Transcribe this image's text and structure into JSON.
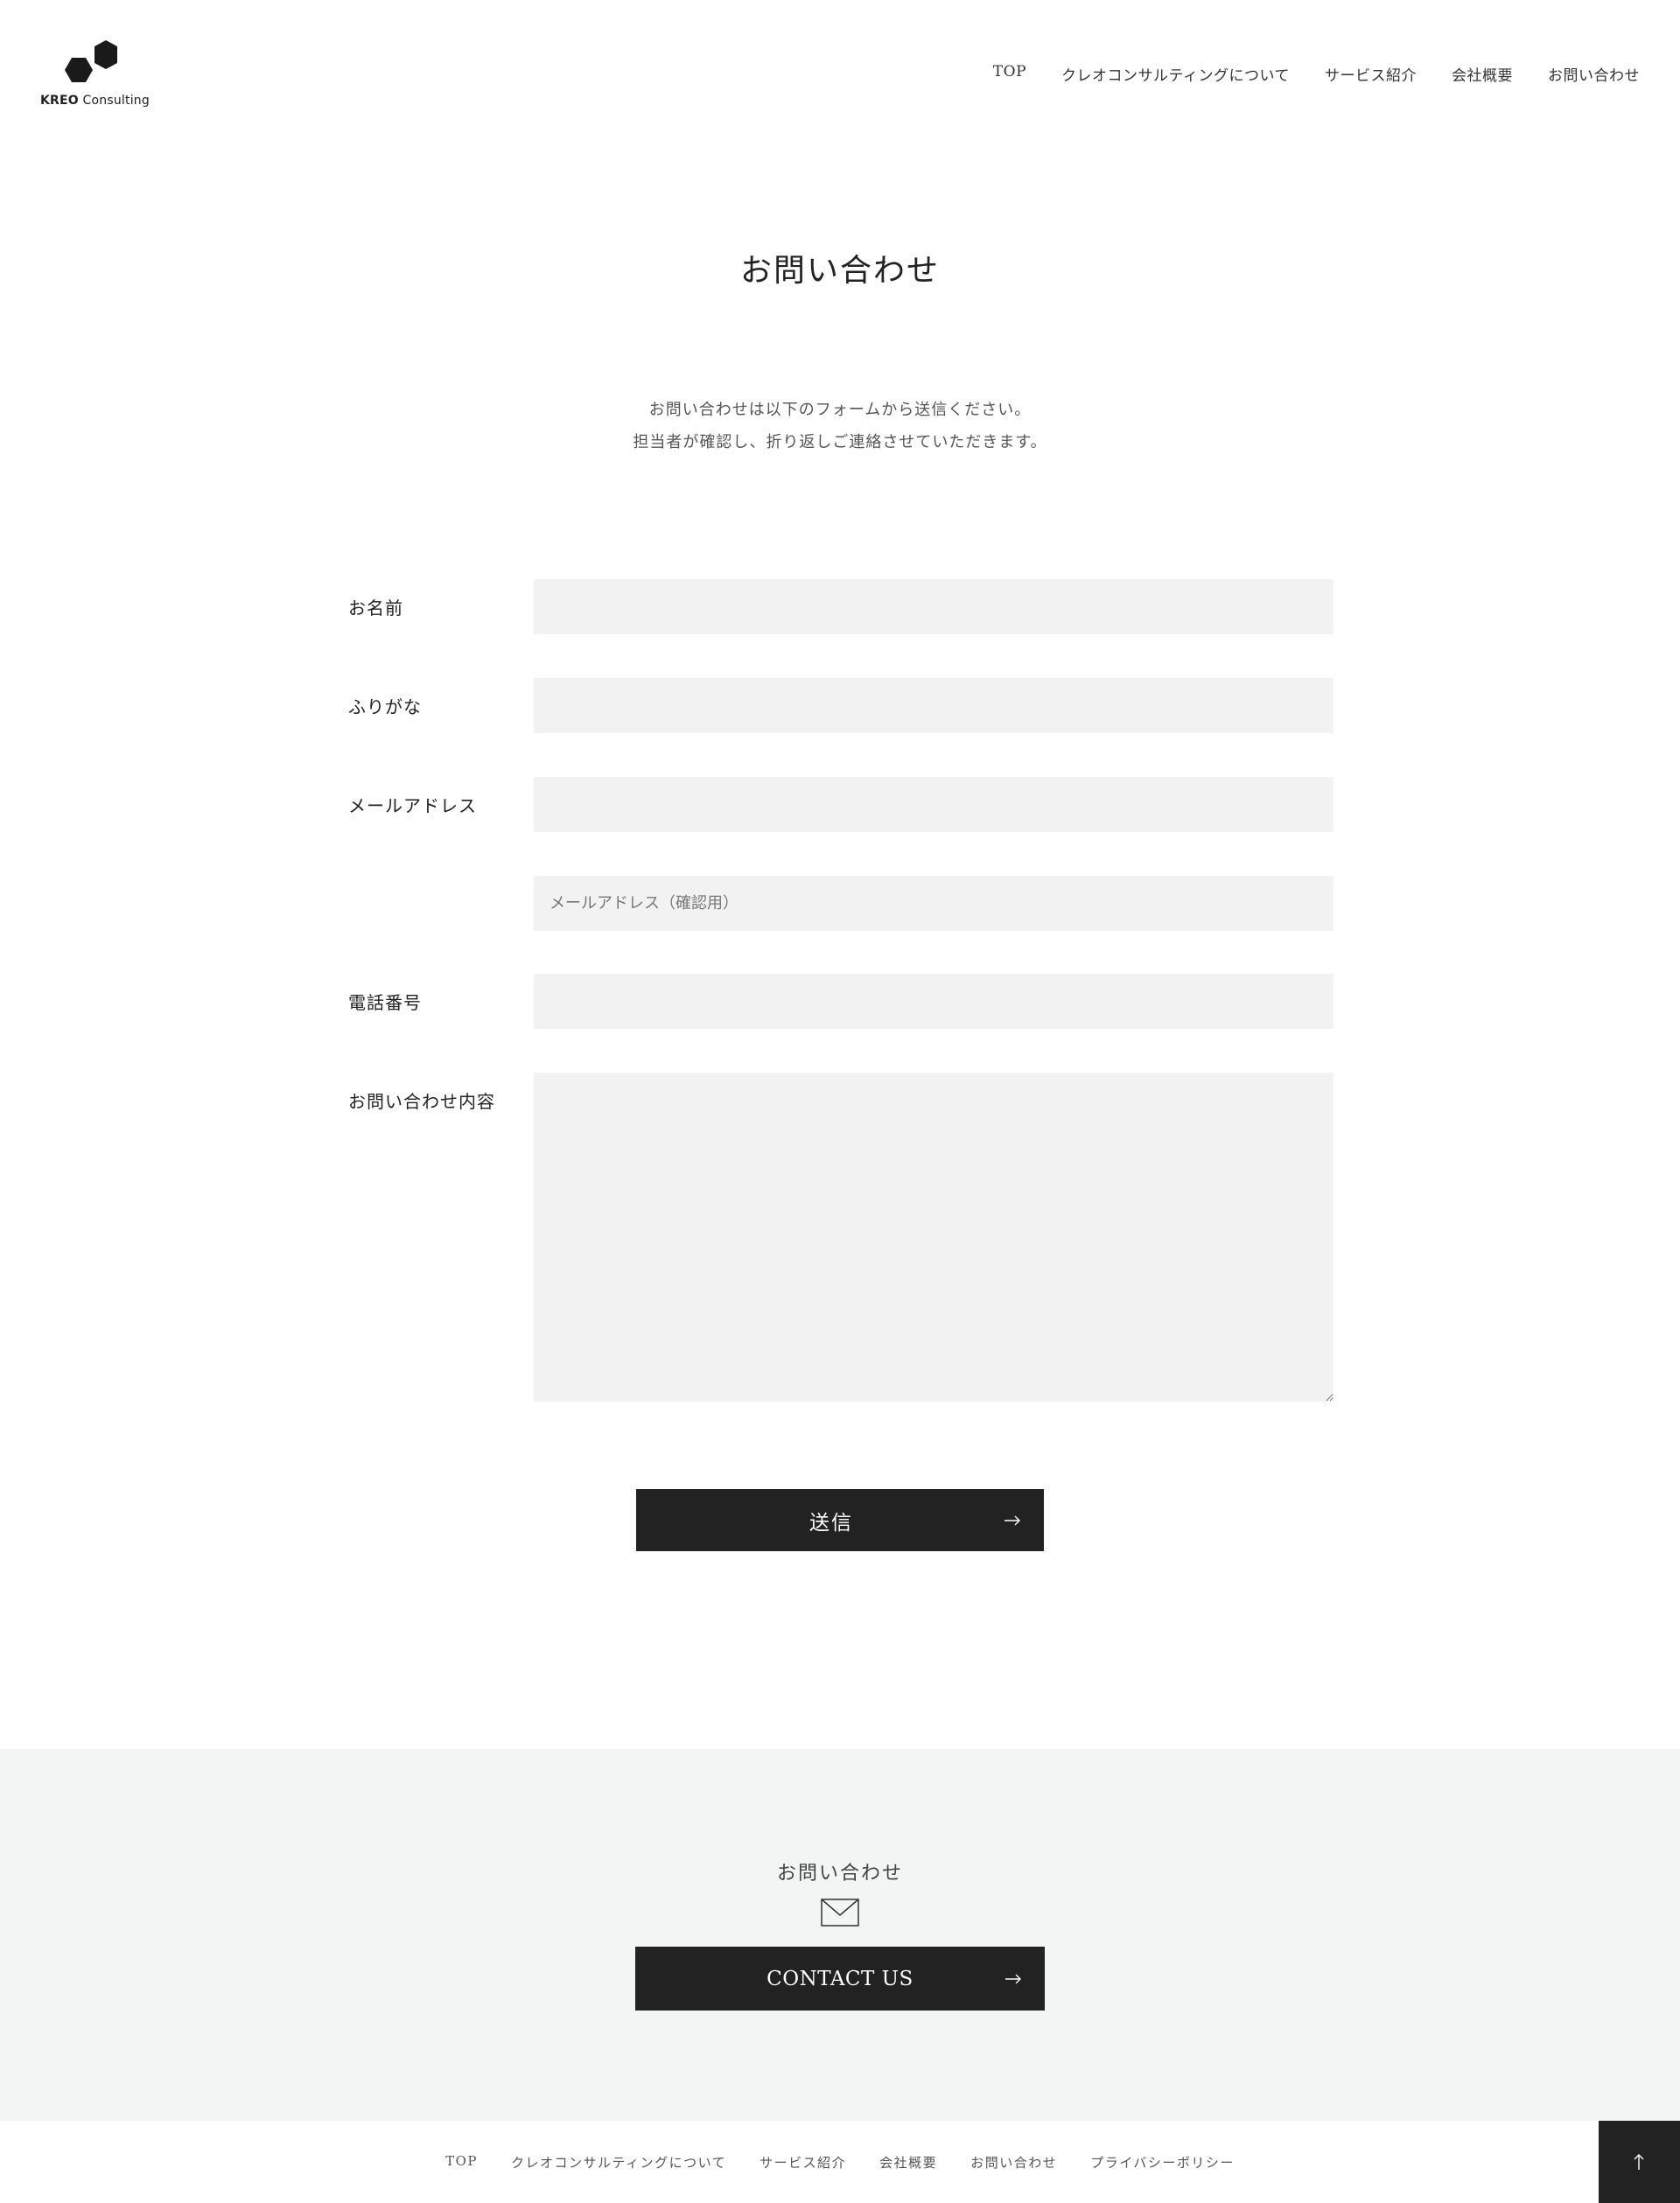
{
  "logo": {
    "brand": "KREO",
    "suffix": " Consulting"
  },
  "nav": {
    "items": [
      {
        "label": "TOP"
      },
      {
        "label": "クレオコンサルティングについて"
      },
      {
        "label": "サービス紹介"
      },
      {
        "label": "会社概要"
      },
      {
        "label": "お問い合わせ"
      }
    ]
  },
  "page": {
    "title": "お問い合わせ",
    "intro_line1": "お問い合わせは以下のフォームから送信ください。",
    "intro_line2": "担当者が確認し、折り返しご連絡させていただきます。"
  },
  "form": {
    "name": {
      "label": "お名前",
      "value": "",
      "placeholder": ""
    },
    "furigana": {
      "label": "ふりがな",
      "value": "",
      "placeholder": ""
    },
    "email": {
      "label": "メールアドレス",
      "value": "",
      "placeholder": ""
    },
    "email_confirm": {
      "value": "",
      "placeholder": "メールアドレス（確認用）"
    },
    "phone": {
      "label": "電話番号",
      "value": "",
      "placeholder": ""
    },
    "message": {
      "label": "お問い合わせ内容",
      "value": "",
      "placeholder": ""
    },
    "submit_label": "送信"
  },
  "contact": {
    "heading": "お問い合わせ",
    "button_label": "CONTACT US"
  },
  "footer": {
    "items": [
      {
        "label": "TOP"
      },
      {
        "label": "クレオコンサルティングについて"
      },
      {
        "label": "サービス紹介"
      },
      {
        "label": "会社概要"
      },
      {
        "label": "お問い合わせ"
      },
      {
        "label": "プライバシーポリシー"
      }
    ]
  },
  "icons": {
    "logo": "hexagon-logo-icon",
    "submit_arrow": "arrow-right-icon",
    "contact_arrow": "arrow-right-icon",
    "mail": "envelope-icon",
    "back_to_top": "arrow-up-icon"
  },
  "colors": {
    "text": "#222222",
    "button_bg": "#222222",
    "button_text": "#ffffff",
    "input_bg": "#f2f2f2",
    "contact_section_bg": "#f3f4f4"
  }
}
